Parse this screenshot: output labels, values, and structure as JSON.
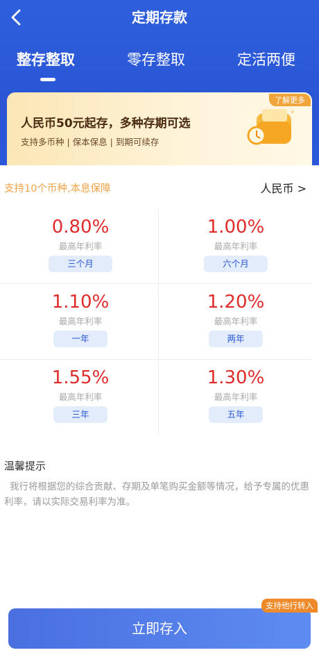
{
  "header": {
    "title": "定期存款",
    "tabs": [
      {
        "label": "整存整取",
        "active": true
      },
      {
        "label": "零存整取",
        "active": false
      },
      {
        "label": "定活两便",
        "active": false
      }
    ]
  },
  "promo": {
    "learn_more": "了解更多",
    "title": "人民币50元起存，多种存期可选",
    "subtitle": "支持多币种 | 保本保息 | 到期可续存",
    "icon": "wallet-icon"
  },
  "currency": {
    "tip": "支持10个币种,本息保障",
    "selected": "人民币 >"
  },
  "rates": [
    {
      "rate": "0.80%",
      "label": "最高年利率",
      "term": "三个月"
    },
    {
      "rate": "1.00%",
      "label": "最高年利率",
      "term": "六个月"
    },
    {
      "rate": "1.10%",
      "label": "最高年利率",
      "term": "一年"
    },
    {
      "rate": "1.20%",
      "label": "最高年利率",
      "term": "两年"
    },
    {
      "rate": "1.55%",
      "label": "最高年利率",
      "term": "三年"
    },
    {
      "rate": "1.30%",
      "label": "最高年利率",
      "term": "五年"
    }
  ],
  "tips": {
    "title": "温馨提示",
    "text": "我行将根据您的综合贡献、存期及单笔购买金额等情况，给予专属的优惠利率，请以实际交易利率为准。"
  },
  "cta": {
    "label": "立即存入",
    "badge": "支持他行转入"
  },
  "colors": {
    "header_blue": "#2b58d8",
    "rate_red": "#e02b2b",
    "tip_orange": "#f0a44a",
    "badge_orange": "#ef8a2b"
  }
}
